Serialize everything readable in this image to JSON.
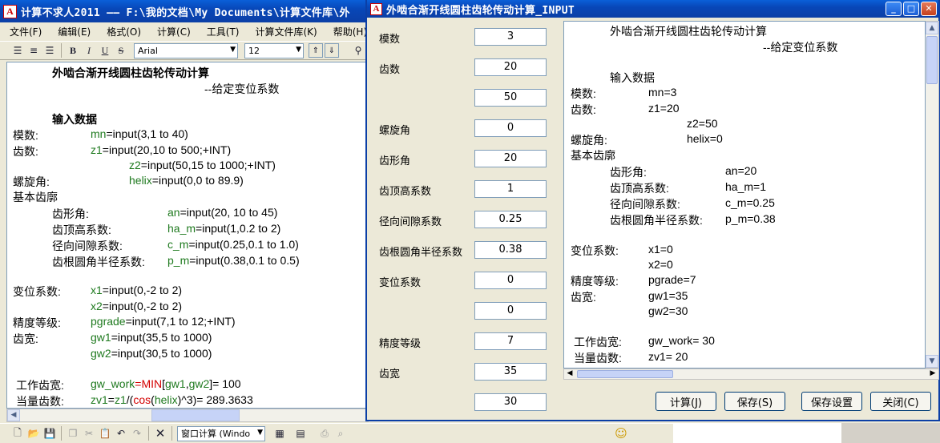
{
  "main": {
    "title": "计算不求人2011 —— F:\\我的文档\\My Documents\\计算文件库\\外",
    "menu": [
      "文件(F)",
      "编辑(E)",
      "格式(O)",
      "计算(C)",
      "工具(T)",
      "计算文件库(K)",
      "帮助(H)"
    ],
    "font_name": "Arial",
    "font_size": "12",
    "toolbar": {
      "bold": "B",
      "italic": "I",
      "underline": "U",
      "strike": "S"
    },
    "doc": {
      "title": "外啮合渐开线圆柱齿轮传动计算",
      "subtitle": "--给定变位系数",
      "section_input": "输入数据",
      "l_module": "模数:",
      "l_teeth": "齿数:",
      "l_helix": "螺旋角:",
      "l_basic": "基本齿廓",
      "l_pressure": "齿形角:",
      "l_addendum": "齿顶高系数:",
      "l_clearance": "径向间隙系数:",
      "l_root": "齿根圆角半径系数:",
      "l_shift": "变位系数:",
      "l_grade": "精度等级:",
      "l_width": "齿宽:",
      "l_work": "工作齿宽:",
      "l_equiv": "当量齿数:",
      "mn_var": "mn",
      "mn_expr": "=input(3,1 to 40)",
      "z1_var": "z1",
      "z1_expr": "=input(20,10 to 500;+INT)",
      "z2_var": "z2",
      "z2_expr": "=input(50,15 to 1000;+INT)",
      "helix_var": "helix",
      "helix_expr": "=input(0,0 to 89.9)",
      "an_var": "an",
      "an_expr": "=input(20, 10 to 45)",
      "ham_var": "ha_m",
      "ham_expr": "=input(1,0.2 to 2)",
      "cm_var": "c_m",
      "cm_expr": "=input(0.25,0.1 to 1.0)",
      "pm_var": "p_m",
      "pm_expr": "=input(0.38,0.1 to 0.5)",
      "x1_var": "x1",
      "x1_expr": "=input(0,-2 to 2)",
      "x2_var": "x2",
      "x2_expr": "=input(0,-2 to 2)",
      "pg_var": "pgrade",
      "pg_expr": "=input(7,1 to 12;+INT)",
      "gw1_var": "gw1",
      "gw1_expr": "=input(35,5 to 1000)",
      "gw2_var": "gw2",
      "gw2_expr": "=input(30,5 to 1000)",
      "gwork_var": "gw_work",
      "gwork_eq": "=",
      "gwork_fn": "MIN",
      "gwork_b1": "[",
      "gwork_a": "gw1",
      "gwork_comma": ",",
      "gwork_b": "gw2",
      "gwork_res": "]= 100",
      "zv1_var": "zv1",
      "zv1_eq": "=",
      "zv1_z1": "z1",
      "zv1_open": "/(",
      "zv1_cos": "cos",
      "zv1_p": "(",
      "zv1_helix": "helix",
      "zv1_res": ")^3)= 289.3633"
    },
    "bottom_combo": "窗口计算 (Windo"
  },
  "dialog": {
    "title": "外啮合渐开线圆柱齿轮传动计算_INPUT",
    "params": [
      {
        "label": "模数",
        "value": "3"
      },
      {
        "label": "齿数",
        "value": "20"
      },
      {
        "label": "",
        "value": "50"
      },
      {
        "label": "螺旋角",
        "value": "0"
      },
      {
        "label": "齿形角",
        "value": "20"
      },
      {
        "label": "齿顶高系数",
        "value": "1"
      },
      {
        "label": "径向间隙系数",
        "value": "0.25"
      },
      {
        "label": "齿根圆角半径系数",
        "value": "0.38"
      },
      {
        "label": "变位系数",
        "value": "0"
      },
      {
        "label": "",
        "value": "0"
      },
      {
        "label": "精度等级",
        "value": "7"
      },
      {
        "label": "齿宽",
        "value": "35"
      },
      {
        "label": "",
        "value": "30"
      }
    ],
    "preview": {
      "title": "外啮合渐开线圆柱齿轮传动计算",
      "subtitle": "--给定变位系数",
      "section_input": "输入数据",
      "l_module": "模数:",
      "v_module": "mn=3",
      "l_teeth": "齿数:",
      "v_z1": "z1=20",
      "v_z2": "z2=50",
      "l_helix": "螺旋角:",
      "v_helix": "helix=0",
      "l_basic": "基本齿廓",
      "l_pressure": "齿形角:",
      "v_an": "an=20",
      "l_addendum": "齿顶高系数:",
      "v_ham": "ha_m=1",
      "l_clearance": "径向间隙系数:",
      "v_cm": "c_m=0.25",
      "l_root": "齿根圆角半径系数:",
      "v_pm": "p_m=0.38",
      "l_shift": "变位系数:",
      "v_x1": "x1=0",
      "v_x2": "x2=0",
      "l_grade": "精度等级:",
      "v_pg": "pgrade=7",
      "l_width": "齿宽:",
      "v_gw1": "gw1=35",
      "v_gw2": "gw2=30",
      "l_work": "工作齿宽:",
      "v_work": "gw_work= 30",
      "l_equiv": "当量齿数:",
      "v_zv1": "zv1= 20"
    },
    "buttons": {
      "calc": "计算(J)",
      "save": "保存(S)",
      "save_settings": "保存设置",
      "close": "关闭(C)"
    }
  }
}
